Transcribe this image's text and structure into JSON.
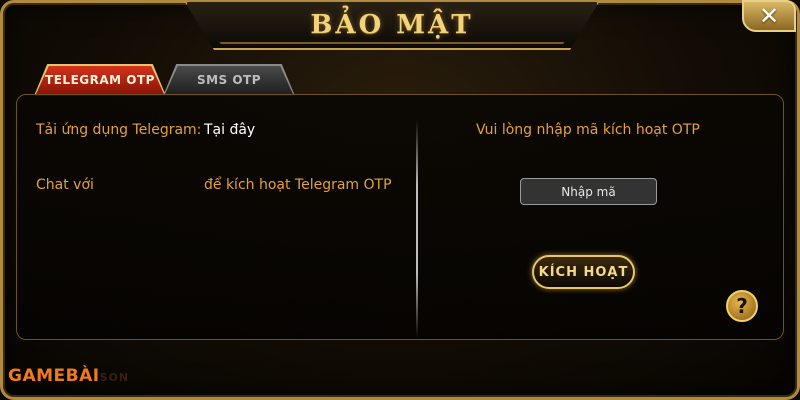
{
  "dialog": {
    "title": "BẢO MẬT",
    "close_icon": "close-icon",
    "close_glyph": "✕"
  },
  "tabs": [
    {
      "label": "TELEGRAM OTP",
      "active": true
    },
    {
      "label": "SMS OTP",
      "active": false
    }
  ],
  "left": {
    "download_label": "Tải ứng dụng Telegram:",
    "download_link": "Tại đây",
    "chat_label": "Chat với",
    "chat_suffix": "để kích hoạt Telegram OTP"
  },
  "right": {
    "instruction": "Vui lòng nhập mã kích hoạt OTP",
    "code_input": {
      "value": "",
      "placeholder": "Nhập mã"
    },
    "activate_label": "KÍCH HOẠT",
    "help_glyph": "?"
  },
  "watermark": {
    "part1": "GAMEBÀI",
    "part2": "SON"
  },
  "colors": {
    "accent_gold": "#f3d37a",
    "label_orange": "#e5a13a",
    "active_tab_red": "#c52a16",
    "brand_orange": "#f07a1c"
  }
}
